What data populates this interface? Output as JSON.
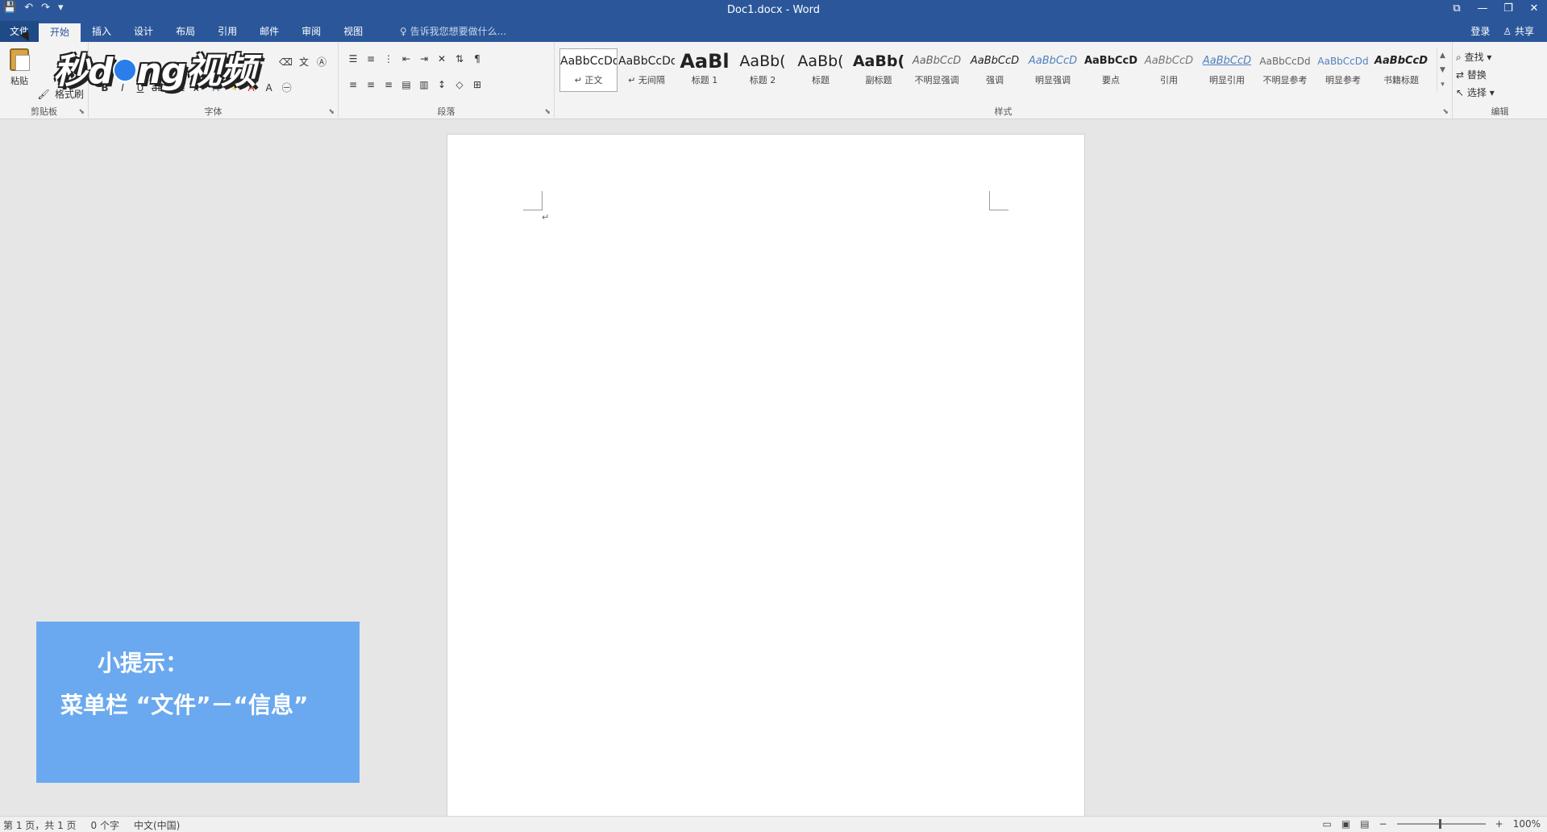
{
  "window": {
    "title": "Doc1.docx - Word",
    "qat": [
      "💾",
      "↶",
      "↷",
      "▾"
    ],
    "controls": [
      "⧉",
      "—",
      "❐",
      "✕"
    ]
  },
  "tabs": [
    {
      "label": "文件"
    },
    {
      "label": "开始"
    },
    {
      "label": "插入"
    },
    {
      "label": "设计"
    },
    {
      "label": "布局"
    },
    {
      "label": "引用"
    },
    {
      "label": "邮件"
    },
    {
      "label": "审阅"
    },
    {
      "label": "视图"
    }
  ],
  "tellme": "告诉我您想要做什么...",
  "account": {
    "signin": "登录",
    "share": "共享"
  },
  "ribbon": {
    "clipboard": {
      "label": "剪贴板",
      "paste": "粘贴",
      "format_painter": "格式刷"
    },
    "font": {
      "label": "字体"
    },
    "paragraph": {
      "label": "段落"
    },
    "styles": {
      "label": "样式",
      "items": [
        {
          "sample": "AaBbCcDd",
          "name": "↵ 正文"
        },
        {
          "sample": "AaBbCcDd",
          "name": "↵ 无间隔"
        },
        {
          "sample": "AaBl",
          "name": "标题 1"
        },
        {
          "sample": "AaBb(",
          "name": "标题 2"
        },
        {
          "sample": "AaBb(",
          "name": "标题"
        },
        {
          "sample": "AaBb(",
          "name": "副标题"
        },
        {
          "sample": "AaBbCcD",
          "name": "不明显强调"
        },
        {
          "sample": "AaBbCcD",
          "name": "强调"
        },
        {
          "sample": "AaBbCcD",
          "name": "明显强调"
        },
        {
          "sample": "AaBbCcD",
          "name": "要点"
        },
        {
          "sample": "AaBbCcD",
          "name": "引用"
        },
        {
          "sample": "AaBbCcD",
          "name": "明显引用"
        },
        {
          "sample": "AaBbCcDd",
          "name": "不明显参考"
        },
        {
          "sample": "AaBbCcDd",
          "name": "明显参考"
        },
        {
          "sample": "AaBbCcD",
          "name": "书籍标题"
        }
      ]
    },
    "editing": {
      "label": "编辑",
      "find": "查找",
      "replace": "替换",
      "select": "选择"
    }
  },
  "tip": {
    "line1": "小提示：",
    "line2": "菜单栏 “文件”－“信息”"
  },
  "logo": {
    "left": "秒d",
    "right": "ng视频"
  },
  "status": {
    "page": "第 1 页，共 1 页",
    "words": "0 个字",
    "lang": "中文(中国)",
    "zoom": "100%"
  }
}
